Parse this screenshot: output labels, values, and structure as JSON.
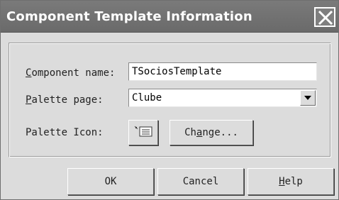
{
  "window": {
    "title": "Component Template Information"
  },
  "form": {
    "component_name": {
      "label_hotkey": "C",
      "label_rest": "omponent name:",
      "value": "TSociosTemplate"
    },
    "palette_page": {
      "label_hotkey": "P",
      "label_rest": "alette page:",
      "value": "Clube"
    },
    "palette_icon": {
      "label": "Palette Icon:",
      "icon": "template-icon",
      "change_pre": "Ch",
      "change_hotkey": "a",
      "change_post": "nge..."
    }
  },
  "buttons": {
    "ok": "OK",
    "cancel": "Cancel",
    "help_hotkey": "H",
    "help_rest": "elp"
  },
  "colors": {
    "titlebar": "#6f6f6f",
    "dialog_bg": "#dcdcdc"
  }
}
